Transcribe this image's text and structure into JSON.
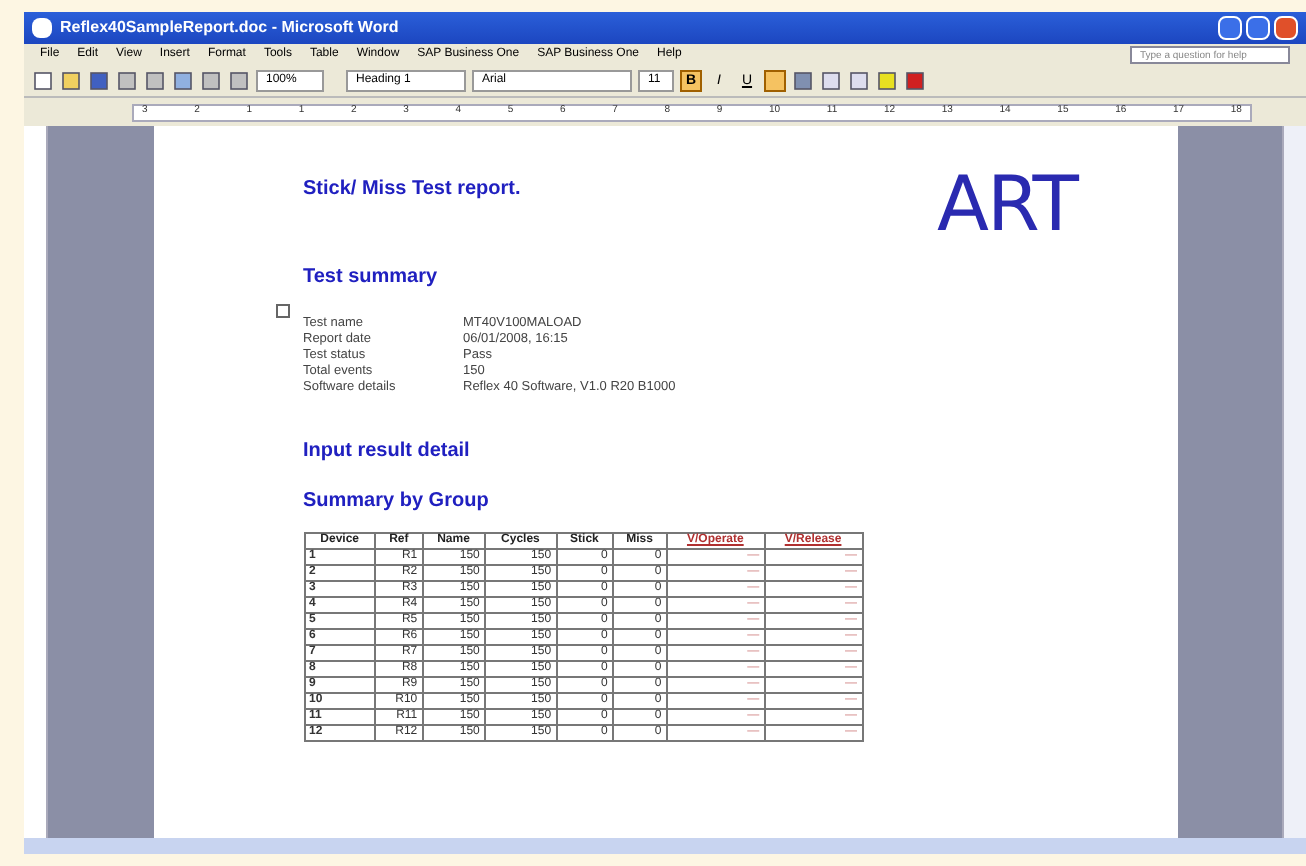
{
  "window": {
    "title": "Reflex40SampleReport.doc - Microsoft Word"
  },
  "menu": [
    "File",
    "Edit",
    "View",
    "Insert",
    "Format",
    "Tools",
    "Table",
    "Window",
    "SAP Business One",
    "SAP Business One",
    "Help"
  ],
  "help_box": {
    "placeholder": "Type a question for help"
  },
  "toolbar": {
    "bold_label": "B",
    "italic_label": "I",
    "underline_label": "U",
    "zoom": "100%",
    "style": "Heading 1",
    "font": "Arial",
    "size": "11",
    "bold": true,
    "italic": false,
    "underline": false,
    "align_left": true
  },
  "ruler": {
    "marks": [
      "3",
      "2",
      "1",
      "1",
      "2",
      "3",
      "4",
      "5",
      "6",
      "7",
      "8",
      "9",
      "10",
      "11",
      "12",
      "13",
      "14",
      "15",
      "16",
      "17",
      "18"
    ]
  },
  "document": {
    "title": "Stick/ Miss Test report.",
    "logo": "ART",
    "summary_heading": "Test summary",
    "summary": [
      {
        "label": "Test name",
        "value": "MT40V100MALOAD"
      },
      {
        "label": "Report date",
        "value": "06/01/2008, 16:15"
      },
      {
        "label": "Test status",
        "value": "Pass"
      },
      {
        "label": "Total events",
        "value": "150"
      },
      {
        "label": "Software details",
        "value": "Reflex 40 Software, V1.0 R20 B1000"
      }
    ],
    "heading_2": "Input result detail",
    "heading_3": "Summary by Group",
    "table": {
      "columns": [
        {
          "label": "Device",
          "highlight": false
        },
        {
          "label": "Ref",
          "highlight": false
        },
        {
          "label": "Name",
          "highlight": false
        },
        {
          "label": "Cycles",
          "highlight": false
        },
        {
          "label": "Stick",
          "highlight": false
        },
        {
          "label": "Miss",
          "highlight": false
        },
        {
          "label": "V/Operate",
          "highlight": true
        },
        {
          "label": "V/Release",
          "highlight": true
        }
      ],
      "rows": [
        [
          "1",
          "R1",
          "150",
          "150",
          "0",
          "0",
          "—",
          "—"
        ],
        [
          "2",
          "R2",
          "150",
          "150",
          "0",
          "0",
          "—",
          "—"
        ],
        [
          "3",
          "R3",
          "150",
          "150",
          "0",
          "0",
          "—",
          "—"
        ],
        [
          "4",
          "R4",
          "150",
          "150",
          "0",
          "0",
          "—",
          "—"
        ],
        [
          "5",
          "R5",
          "150",
          "150",
          "0",
          "0",
          "—",
          "—"
        ],
        [
          "6",
          "R6",
          "150",
          "150",
          "0",
          "0",
          "—",
          "—"
        ],
        [
          "7",
          "R7",
          "150",
          "150",
          "0",
          "0",
          "—",
          "—"
        ],
        [
          "8",
          "R8",
          "150",
          "150",
          "0",
          "0",
          "—",
          "—"
        ],
        [
          "9",
          "R9",
          "150",
          "150",
          "0",
          "0",
          "—",
          "—"
        ],
        [
          "10",
          "R10",
          "150",
          "150",
          "0",
          "0",
          "—",
          "—"
        ],
        [
          "11",
          "R11",
          "150",
          "150",
          "0",
          "0",
          "—",
          "—"
        ],
        [
          "12",
          "R12",
          "150",
          "150",
          "0",
          "0",
          "—",
          "—"
        ]
      ]
    }
  }
}
